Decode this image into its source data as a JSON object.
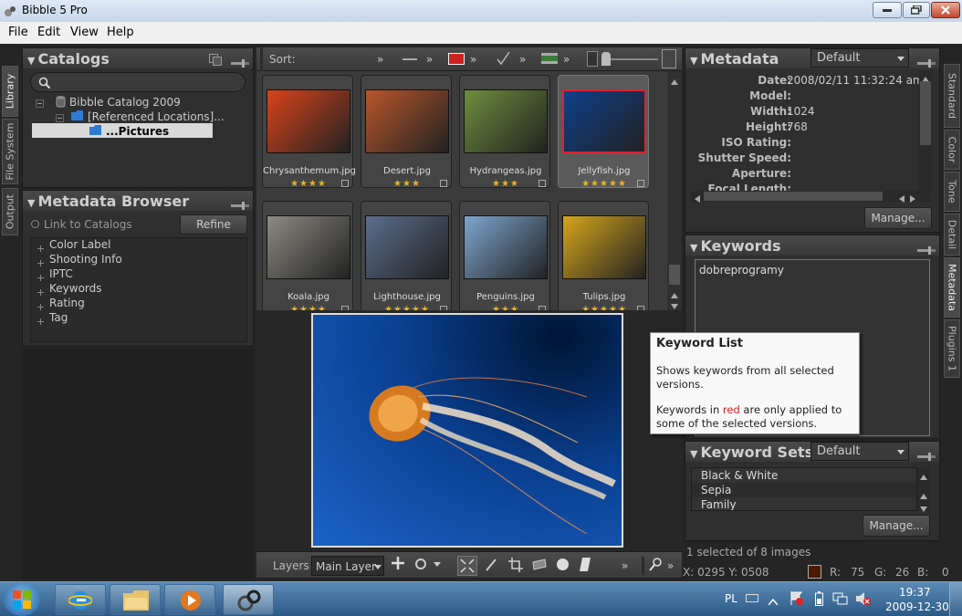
{
  "window": {
    "title": "Bibble 5 Pro"
  },
  "menu": [
    "File",
    "Edit",
    "View",
    "Help"
  ],
  "left_tabs": [
    "Library",
    "File System",
    "Output"
  ],
  "catalogs": {
    "title": "Catalogs",
    "tree": [
      "Bibble Catalog 2009",
      "[Referenced Locations]...",
      "...Pictures"
    ]
  },
  "metadata_browser": {
    "title": "Metadata Browser",
    "link_label": "Link to Catalogs",
    "refine_label": "Refine",
    "items": [
      "Color Label",
      "Shooting Info",
      "IPTC",
      "Keywords",
      "Rating",
      "Tag"
    ]
  },
  "sort_label": "Sort:",
  "thumbnails": [
    {
      "name": "Chrysanthemum.jpg",
      "rating": 4,
      "stars": "★★★★",
      "color": "#d9431a"
    },
    {
      "name": "Desert.jpg",
      "rating": 3,
      "stars": "★★★",
      "color": "#b8562a"
    },
    {
      "name": "Hydrangeas.jpg",
      "rating": 3,
      "stars": "★★★",
      "color": "#6e8e3c"
    },
    {
      "name": "Jellyfish.jpg",
      "rating": 5,
      "stars": "★★★★★",
      "color": "#0d3f8a"
    },
    {
      "name": "Koala.jpg",
      "rating": 4,
      "stars": "★★★★",
      "color": "#8c8a82"
    },
    {
      "name": "Lighthouse.jpg",
      "rating": 5,
      "stars": "★★★★★",
      "color": "#5b6e8c"
    },
    {
      "name": "Penguins.jpg",
      "rating": 3,
      "stars": "★★★",
      "color": "#7ea6cf"
    },
    {
      "name": "Tulips.jpg",
      "rating": 5,
      "stars": "★★★★★",
      "color": "#d7a51c"
    }
  ],
  "preview_toolbar": {
    "layers_label": "Layers",
    "layer_value": "Main Layer"
  },
  "metadata_panel": {
    "title": "Metadata",
    "preset": "Default",
    "fields": [
      {
        "label": "Date:",
        "value": "2008/02/11 11:32:24 am"
      },
      {
        "label": "Model:",
        "value": ""
      },
      {
        "label": "Width:",
        "value": "1024"
      },
      {
        "label": "Height:",
        "value": "768"
      },
      {
        "label": "ISO Rating:",
        "value": ""
      },
      {
        "label": "Shutter Speed:",
        "value": ""
      },
      {
        "label": "Aperture:",
        "value": ""
      },
      {
        "label": "Focal Length:",
        "value": ""
      }
    ],
    "manage_label": "Manage..."
  },
  "keywords_panel": {
    "title": "Keywords",
    "value": "dobreprogramy"
  },
  "tooltip": {
    "title": "Keyword List",
    "line1": "Shows keywords from all selected versions.",
    "line2_pre": "Keywords in ",
    "line2_red": "red",
    "line2_post": " are only applied to some of the selected versions."
  },
  "keyword_sets": {
    "title": "Keyword Sets",
    "preset": "Default",
    "items": [
      "Black & White",
      "Sepia",
      "Family"
    ],
    "manage_label": "Manage..."
  },
  "right_tabs": [
    "Standard",
    "Color",
    "Tone",
    "Detail",
    "Metadata",
    "Plugins 1"
  ],
  "status": {
    "selection": "1 selected of 8 images",
    "coords": "X: 0295  Y: 0508",
    "r_label": "R:",
    "r_value": "75",
    "g_label": "G:",
    "g_value": "26",
    "b_label": "B:",
    "b_value": "0",
    "swatch_color": "#4b1a00"
  },
  "taskbar": {
    "lang": "PL",
    "time": "19:37",
    "date": "2009-12-30"
  }
}
